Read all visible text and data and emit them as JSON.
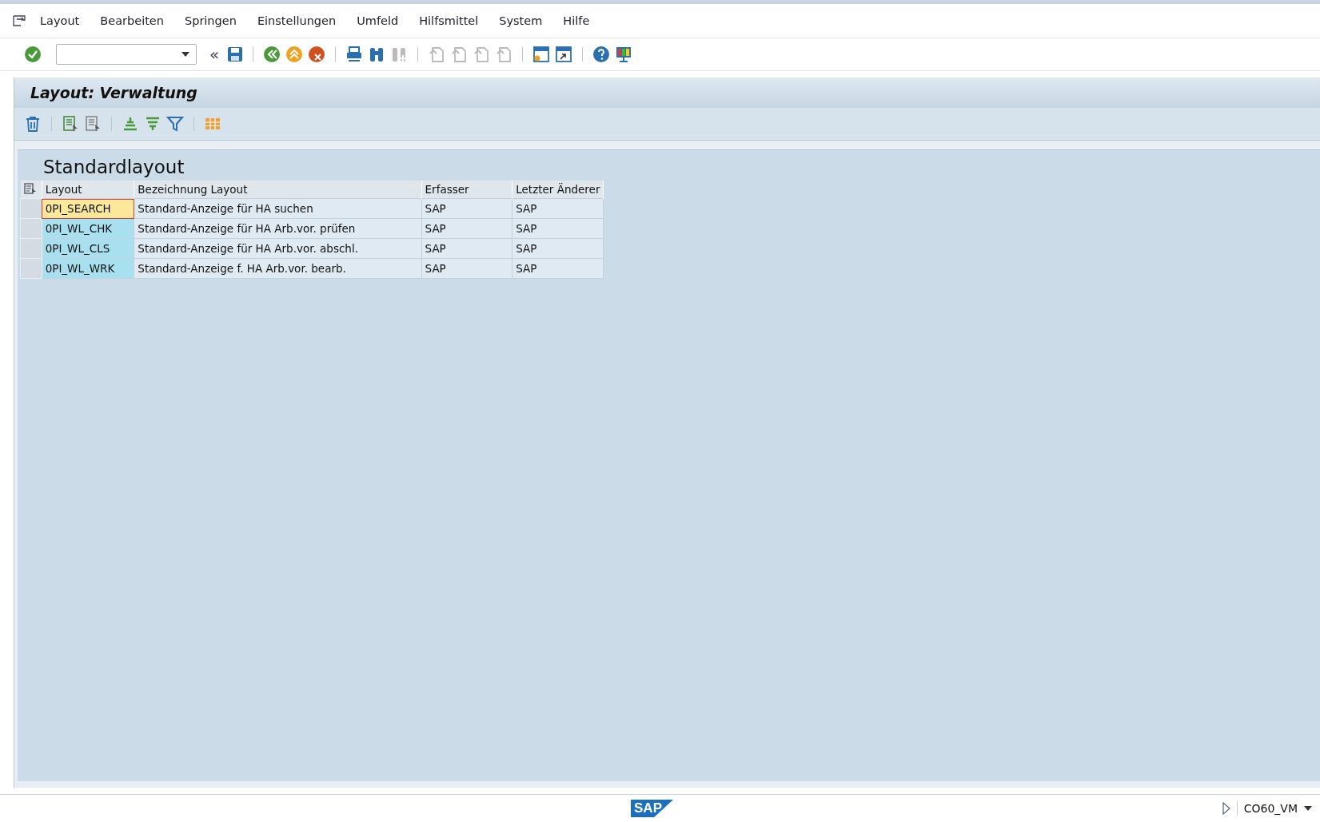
{
  "menu": [
    {
      "label": "Layout"
    },
    {
      "label": "Bearbeiten"
    },
    {
      "label": "Springen"
    },
    {
      "label": "Einstellungen"
    },
    {
      "label": "Umfeld"
    },
    {
      "label": "Hilfsmittel"
    },
    {
      "label": "System"
    },
    {
      "label": "Hilfe"
    }
  ],
  "toolbar": {
    "back_arrows": "«"
  },
  "title": "Layout: Verwaltung",
  "section_title": "Standardlayout",
  "table": {
    "columns": [
      "Layout",
      "Bezeichnung Layout",
      "Erfasser",
      "Letzter Änderer"
    ],
    "rows": [
      {
        "cells": [
          "0PI_SEARCH",
          "Standard-Anzeige für HA suchen",
          "SAP",
          "SAP"
        ],
        "selected": true
      },
      {
        "cells": [
          "0PI_WL_CHK",
          "Standard-Anzeige für HA Arb.vor. prüfen",
          "SAP",
          "SAP"
        ],
        "selected": false
      },
      {
        "cells": [
          "0PI_WL_CLS",
          "Standard-Anzeige für HA Arb.vor. abschl.",
          "SAP",
          "SAP"
        ],
        "selected": false
      },
      {
        "cells": [
          "0PI_WL_WRK",
          "Standard-Anzeige f. HA Arb.vor. bearb.",
          "SAP",
          "SAP"
        ],
        "selected": false
      }
    ]
  },
  "status_bar": {
    "logo": "SAP",
    "system": "CO60_VM"
  }
}
